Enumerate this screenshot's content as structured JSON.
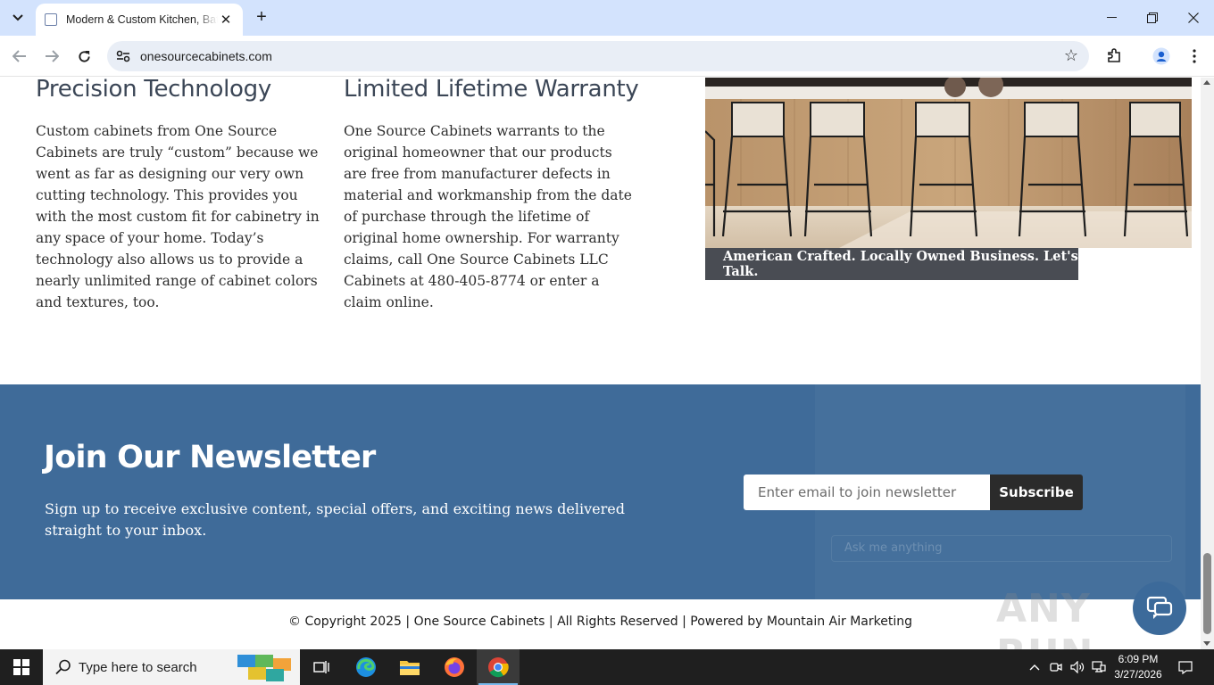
{
  "browser": {
    "tab_title": "Modern & Custom Kitchen, Bath",
    "url": "onesourcecabinets.com"
  },
  "content": {
    "col1": {
      "heading": "Precision Technology",
      "body": "Custom cabinets from One Source Cabinets are truly “custom” because we went as far as designing our very own cutting technology. This provides you with the most custom fit for cabinetry in any space of your home. Today’s technology also allows us to provide a nearly unlimited range of cabinet colors and textures, too."
    },
    "col2": {
      "heading": "Limited Lifetime Warranty",
      "body": "One Source Cabinets warrants to the original homeowner that our products are free from manufacturer defects in material and workmanship from the date of purchase through the lifetime of original home ownership. For warranty claims, call One Source Cabinets LLC Cabinets at 480-405-8774 or enter a claim online."
    },
    "image_caption": "American Crafted. Locally Owned Business. Let's Talk."
  },
  "newsletter": {
    "title": "Join Our Newsletter",
    "text": "Sign up to receive exclusive content, special offers, and exciting news delivered straight to your inbox.",
    "email_placeholder": "Enter email to join newsletter",
    "subscribe_label": "Subscribe",
    "chat_placeholder": "Ask me anything"
  },
  "footer": {
    "copyright": "© Copyright 2025 | One Source Cabinets | All Rights Reserved | Powered by Mountain Air Marketing"
  },
  "watermark": "ANY RUN",
  "taskbar": {
    "search_placeholder": "Type here to search",
    "time": "6:09 PM",
    "date": "3/27/2026"
  },
  "colors": {
    "newsletter_bg": "#3f6b99",
    "caption_bg": "#494c53",
    "subscribe_bg": "#2b2b2b",
    "tabbar_bg": "#d3e3fd"
  }
}
